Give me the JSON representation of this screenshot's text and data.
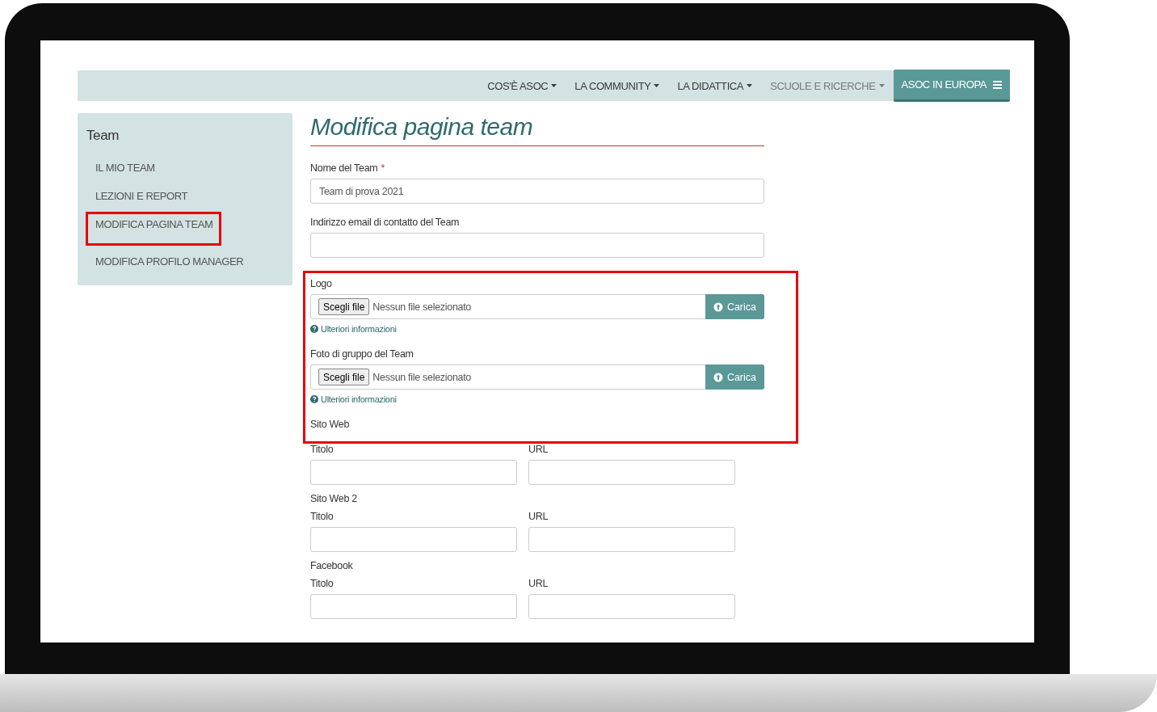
{
  "navbar": {
    "items": [
      {
        "label": "COS'È ASOC",
        "kind": "dropdown",
        "disabled": false
      },
      {
        "label": "LA COMMUNITY",
        "kind": "dropdown",
        "disabled": false
      },
      {
        "label": "LA DIDATTICA",
        "kind": "dropdown",
        "disabled": false
      },
      {
        "label": "SCUOLE E RICERCHE",
        "kind": "dropdown",
        "disabled": true
      },
      {
        "label": "ASOC IN EUROPA",
        "kind": "menu-button"
      }
    ]
  },
  "sidebar": {
    "title": "Team",
    "items": [
      {
        "label": "IL MIO TEAM",
        "highlighted": false
      },
      {
        "label": "LEZIONI E REPORT",
        "highlighted": false
      },
      {
        "label": "MODIFICA PAGINA TEAM",
        "highlighted": true
      },
      {
        "label": "MODIFICA PROFILO MANAGER",
        "highlighted": false
      }
    ]
  },
  "form": {
    "title": "Modifica pagina team",
    "sections": [
      {
        "highlighted": false,
        "fields": [
          {
            "kind": "text",
            "label": "Nome del Team",
            "required_mark": "*",
            "value": "Team di prova 2021"
          },
          {
            "kind": "text",
            "label": "Indirizzo email di contatto del Team"
          }
        ]
      },
      {
        "highlighted": true,
        "fields": [
          {
            "kind": "file",
            "label": "Logo",
            "button": "Scegli file",
            "status": "Nessun file selezionato",
            "upload": "Carica",
            "help": "Ulteriori informazioni"
          },
          {
            "kind": "file",
            "label": "Foto di gruppo del Team",
            "button": "Scegli file",
            "status": "Nessun file selezionato",
            "upload": "Carica",
            "help": "Ulteriori informazioni"
          },
          {
            "kind": "heading",
            "label": "Sito Web"
          }
        ]
      },
      {
        "highlighted": false,
        "fields": [
          {
            "kind": "pair",
            "title_label": "Titolo",
            "url_label": "URL"
          },
          {
            "kind": "heading",
            "label": "Sito Web 2"
          },
          {
            "kind": "pair",
            "title_label": "Titolo",
            "url_label": "URL"
          },
          {
            "kind": "heading",
            "label": "Facebook"
          },
          {
            "kind": "pair",
            "title_label": "Titolo",
            "url_label": "URL"
          }
        ]
      }
    ]
  }
}
